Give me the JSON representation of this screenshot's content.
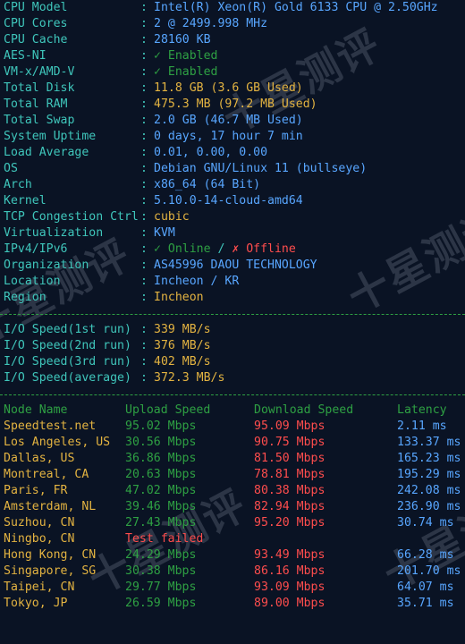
{
  "sysinfo": [
    {
      "key": "CPU Model",
      "value": "Intel(R) Xeon(R) Gold 6133 CPU @ 2.50GHz",
      "style": "blue"
    },
    {
      "key": "CPU Cores",
      "value": "2 @ 2499.998 MHz",
      "style": "blue"
    },
    {
      "key": "CPU Cache",
      "value": "28160 KB",
      "style": "blue"
    },
    {
      "key": "AES-NI",
      "value": "✓ Enabled",
      "style": "ok"
    },
    {
      "key": "VM-x/AMD-V",
      "value": "✓ Enabled",
      "style": "ok"
    },
    {
      "key": "Total Disk",
      "value": "11.8 GB (3.6 GB Used)",
      "style": "yellow"
    },
    {
      "key": "Total RAM",
      "value": "475.3 MB (97.2 MB Used)",
      "style": "yellow"
    },
    {
      "key": "Total Swap",
      "value": "2.0 GB (46.7 MB Used)",
      "style": "blue"
    },
    {
      "key": "System Uptime",
      "value": "0 days, 17 hour 7 min",
      "style": "blue"
    },
    {
      "key": "Load Average",
      "value": "0.01, 0.00, 0.00",
      "style": "blue"
    },
    {
      "key": "OS",
      "value": "Debian GNU/Linux 11 (bullseye)",
      "style": "blue"
    },
    {
      "key": "Arch",
      "value": "x86_64 (64 Bit)",
      "style": "blue"
    },
    {
      "key": "Kernel",
      "value": "5.10.0-14-cloud-amd64",
      "style": "blue"
    },
    {
      "key": "TCP Congestion Ctrl",
      "value": "cubic",
      "style": "yellow"
    },
    {
      "key": "Virtualization",
      "value": "KVM",
      "style": "blue"
    }
  ],
  "ipv": {
    "key": "IPv4/IPv6",
    "online": "✓ Online",
    "slash": " / ",
    "offline": "✗ Offline"
  },
  "sysinfo2": [
    {
      "key": "Organization",
      "value": "AS45996 DAOU TECHNOLOGY",
      "style": "blue"
    },
    {
      "key": "Location",
      "value": "Incheon / KR",
      "style": "blue"
    },
    {
      "key": "Region",
      "value": "Incheon",
      "style": "yellow"
    }
  ],
  "io": [
    {
      "key": "I/O Speed(1st run)",
      "value": "339 MB/s"
    },
    {
      "key": "I/O Speed(2nd run)",
      "value": "376 MB/s"
    },
    {
      "key": "I/O Speed(3rd run)",
      "value": "402 MB/s"
    },
    {
      "key": "I/O Speed(average)",
      "value": "372.3 MB/s"
    }
  ],
  "speed_header": {
    "node": "Node Name",
    "upload": "Upload Speed",
    "download": "Download Speed",
    "latency": "Latency"
  },
  "speedtests": [
    {
      "node": "Speedtest.net",
      "upload": "95.02 Mbps",
      "download": "95.09 Mbps",
      "latency": "2.11 ms"
    },
    {
      "node": "Los Angeles, US",
      "upload": "30.56 Mbps",
      "download": "90.75 Mbps",
      "latency": "133.37 ms"
    },
    {
      "node": "Dallas, US",
      "upload": "36.86 Mbps",
      "download": "81.50 Mbps",
      "latency": "165.23 ms"
    },
    {
      "node": "Montreal, CA",
      "upload": "20.63 Mbps",
      "download": "78.81 Mbps",
      "latency": "195.29 ms"
    },
    {
      "node": "Paris, FR",
      "upload": "47.02 Mbps",
      "download": "80.38 Mbps",
      "latency": "242.08 ms"
    },
    {
      "node": "Amsterdam, NL",
      "upload": "39.46 Mbps",
      "download": "82.94 Mbps",
      "latency": "236.90 ms"
    },
    {
      "node": "Suzhou, CN",
      "upload": "27.43 Mbps",
      "download": "95.20 Mbps",
      "latency": "30.74 ms"
    },
    {
      "node": "Ningbo, CN",
      "upload": "Test failed",
      "download": "",
      "latency": ""
    },
    {
      "node": "Hong Kong, CN",
      "upload": "24.29 Mbps",
      "download": "93.49 Mbps",
      "latency": "66.28 ms"
    },
    {
      "node": "Singapore, SG",
      "upload": "30.38 Mbps",
      "download": "86.16 Mbps",
      "latency": "201.70 ms"
    },
    {
      "node": "Taipei, CN",
      "upload": "29.77 Mbps",
      "download": "93.09 Mbps",
      "latency": "64.07 ms"
    },
    {
      "node": "Tokyo, JP",
      "upload": "26.59 Mbps",
      "download": "89.00 Mbps",
      "latency": "35.71 ms"
    }
  ],
  "separator": ":",
  "watermark_text": "十星测评",
  "colors": {
    "background": "#0a1324",
    "key": "#3fc6bb",
    "value_blue": "#58a6ff",
    "value_yellow": "#e3b341",
    "ok_green": "#2ea043",
    "error_red": "#ff4d4d"
  }
}
